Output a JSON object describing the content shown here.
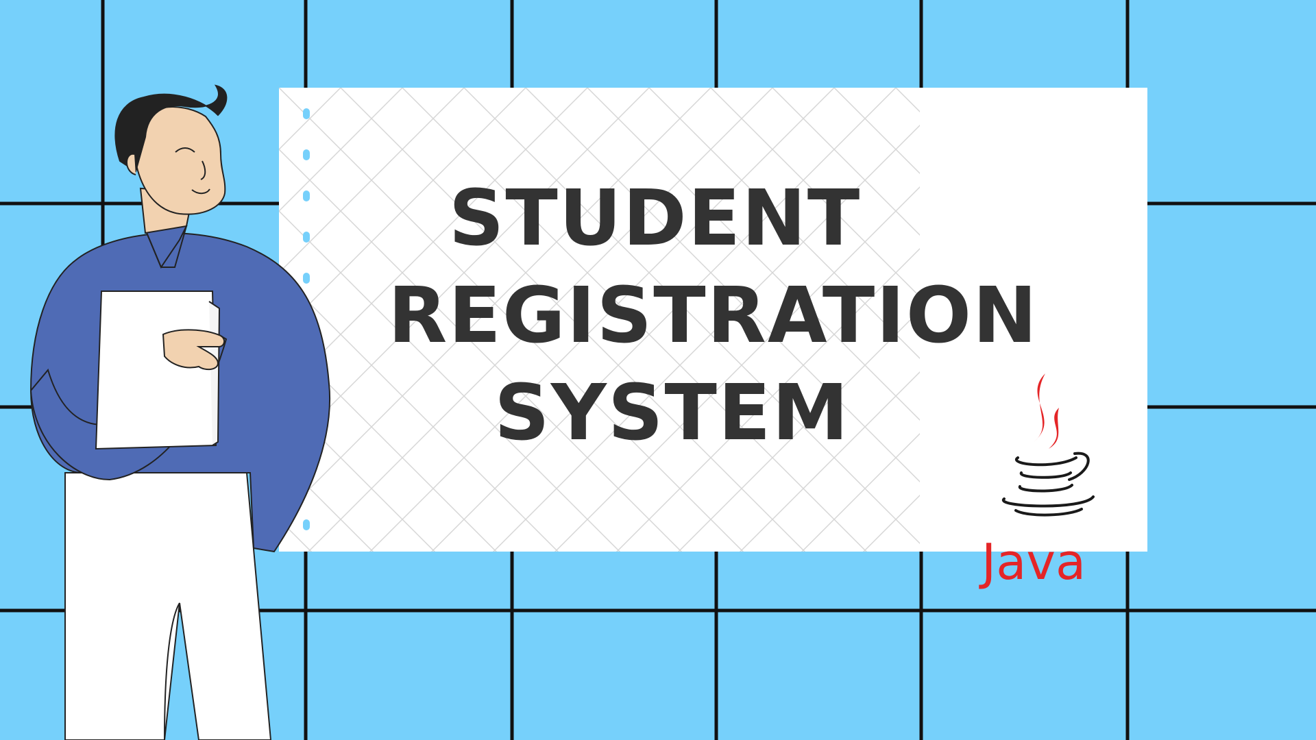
{
  "title": {
    "line1": "STUDENT",
    "line2": "REGISTRATION",
    "line3": "SYSTEM"
  },
  "java": {
    "label": "Java"
  },
  "colors": {
    "background": "#76d0fb",
    "grid_lines": "#111111",
    "paper": "#ffffff",
    "title_text": "#333333",
    "java_red": "#e42527",
    "sweater": "#4f6bb5",
    "hair": "#222222",
    "skin": "#f2d2b0",
    "trousers": "#ffffff"
  },
  "icons": [
    "java-coffee-cup-icon",
    "person-illustration",
    "notebook-holes"
  ]
}
